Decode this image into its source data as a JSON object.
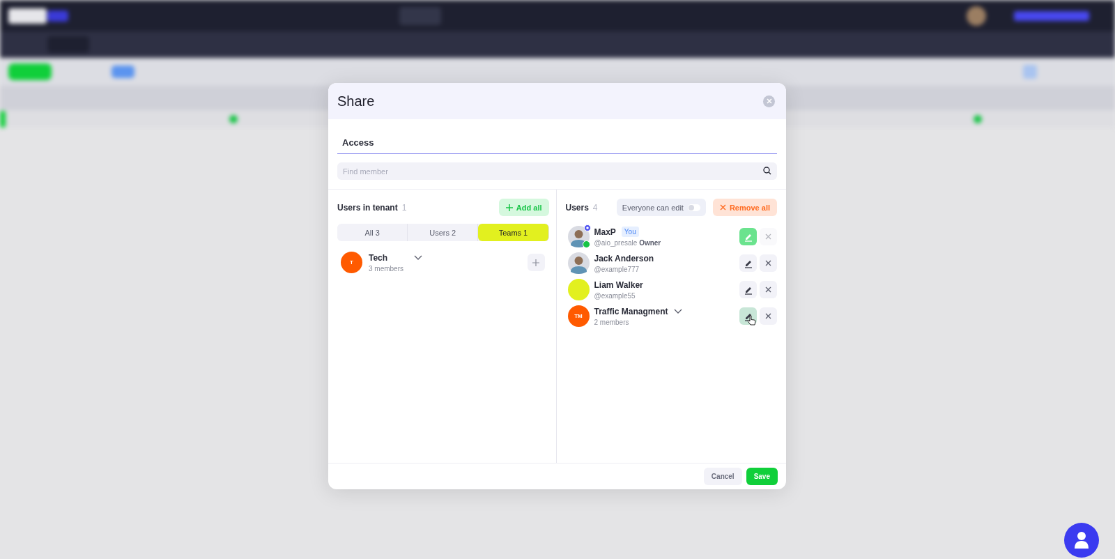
{
  "dialog": {
    "title": "Share",
    "tabs": [
      {
        "label": "Access",
        "selected": true
      }
    ],
    "search": {
      "placeholder": "Find member"
    },
    "tenant": {
      "title": "Users in tenant",
      "count": "1",
      "add_all": "Add all",
      "filters": [
        {
          "label": "All 3",
          "selected": false
        },
        {
          "label": "Users 2",
          "selected": false
        },
        {
          "label": "Teams 1",
          "selected": true
        }
      ],
      "items": [
        {
          "kind": "team",
          "initials": "T",
          "color": "#ff5a00",
          "name": "Tech",
          "detail": "3 members"
        }
      ]
    },
    "users": {
      "title": "Users",
      "count": "4",
      "toggle": {
        "label": "Everyone can edit",
        "on": false
      },
      "remove_all": "Remove all",
      "members": [
        {
          "kind": "user",
          "name": "MaxP",
          "badge": "You",
          "handle": "@aio_presale",
          "role": "Owner",
          "online": true,
          "can_edit": true,
          "hovered": false,
          "remove_disabled": true
        },
        {
          "kind": "user",
          "name": "Jack Anderson",
          "handle": "@example777",
          "online": false,
          "can_edit": false,
          "hovered": false,
          "remove_disabled": false
        },
        {
          "kind": "user",
          "color": "#e2f01f",
          "name": "Liam Walker",
          "handle": "@example55",
          "online": false,
          "can_edit": false,
          "hovered": false,
          "remove_disabled": false
        },
        {
          "kind": "team",
          "color": "#ff5a00",
          "initials": "TM",
          "name": "Traffic Managment",
          "handle": "2 members",
          "online": false,
          "can_edit": false,
          "hovered": true,
          "remove_disabled": false
        }
      ]
    },
    "buttons": [
      {
        "kind": "cancel",
        "label": "Cancel"
      },
      {
        "kind": "save",
        "label": "Save"
      }
    ]
  }
}
